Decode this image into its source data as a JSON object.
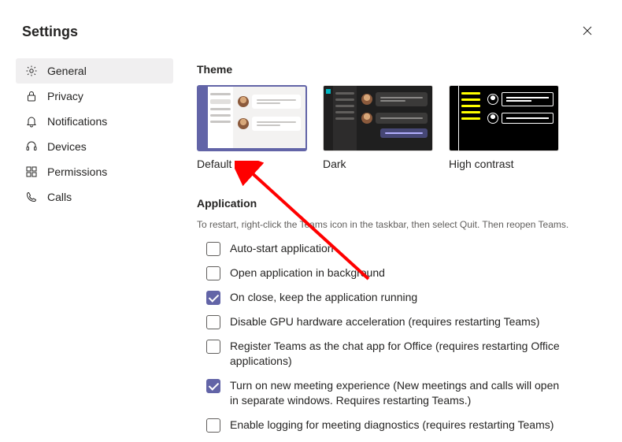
{
  "header": {
    "title": "Settings"
  },
  "sidebar": {
    "items": [
      {
        "label": "General"
      },
      {
        "label": "Privacy"
      },
      {
        "label": "Notifications"
      },
      {
        "label": "Devices"
      },
      {
        "label": "Permissions"
      },
      {
        "label": "Calls"
      }
    ],
    "active_index": 0
  },
  "theme": {
    "section_title": "Theme",
    "options": [
      {
        "label": "Default"
      },
      {
        "label": "Dark"
      },
      {
        "label": "High contrast"
      }
    ],
    "selected_index": 0
  },
  "application": {
    "section_title": "Application",
    "note": "To restart, right-click the Teams icon in the taskbar, then select Quit. Then reopen Teams.",
    "options": [
      {
        "label": "Auto-start application",
        "checked": false
      },
      {
        "label": "Open application in background",
        "checked": false
      },
      {
        "label": "On close, keep the application running",
        "checked": true
      },
      {
        "label": "Disable GPU hardware acceleration (requires restarting Teams)",
        "checked": false
      },
      {
        "label": "Register Teams as the chat app for Office (requires restarting Office applications)",
        "checked": false
      },
      {
        "label": "Turn on new meeting experience (New meetings and calls will open in separate windows. Requires restarting Teams.)",
        "checked": true
      },
      {
        "label": "Enable logging for meeting diagnostics (requires restarting Teams)",
        "checked": false
      }
    ]
  }
}
